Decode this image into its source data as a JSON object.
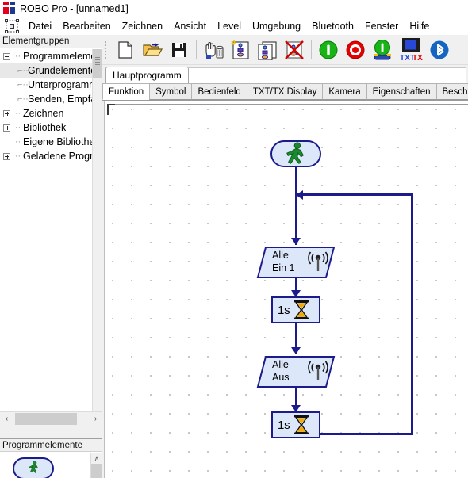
{
  "window": {
    "title": "ROBO Pro - [unnamed1]",
    "app_icon": "fischertechnik-ft-logo-icon"
  },
  "menubar": {
    "system_icon": "program-node-icon",
    "items": [
      {
        "label": "Datei"
      },
      {
        "label": "Bearbeiten"
      },
      {
        "label": "Zeichnen"
      },
      {
        "label": "Ansicht"
      },
      {
        "label": "Level"
      },
      {
        "label": "Umgebung"
      },
      {
        "label": "Bluetooth"
      },
      {
        "label": "Fenster"
      },
      {
        "label": "Hilfe"
      }
    ]
  },
  "toolbar": {
    "buttons": [
      {
        "name": "new-file-button",
        "icon": "new-document-icon",
        "label": "Neu"
      },
      {
        "name": "open-file-button",
        "icon": "open-folder-icon",
        "label": "Öffnen"
      },
      {
        "name": "save-file-button",
        "icon": "floppy-disk-save-icon",
        "label": "Speichern"
      },
      {
        "name": "delete-tool-button",
        "icon": "hand-trash-icon",
        "label": "Löschen"
      },
      {
        "name": "new-subprogram-button",
        "icon": "new-subprogram-icon",
        "label": "Neues Unterprogramm"
      },
      {
        "name": "copy-subprogram-button",
        "icon": "copy-subprogram-icon",
        "label": "Unterprogramm kopieren"
      },
      {
        "name": "delete-subprogram-button",
        "icon": "delete-subprogram-icon",
        "label": "Unterprogramm löschen"
      },
      {
        "name": "start-button",
        "icon": "green-start-icon",
        "label": "Start"
      },
      {
        "name": "stop-button",
        "icon": "red-stop-icon",
        "label": "Stop"
      },
      {
        "name": "start-robot-button",
        "icon": "green-start-robot-icon",
        "label": "Start im Download-Modus"
      },
      {
        "name": "txt-interface-button",
        "icon": "txt-tx-controller-icon",
        "label": "TXT/TX"
      },
      {
        "name": "bluetooth-button",
        "icon": "bluetooth-icon",
        "label": "Bluetooth"
      }
    ]
  },
  "tree_panel": {
    "header": "Elementgruppen",
    "items": [
      {
        "label": "Programmelemente",
        "level": 0,
        "toggle": "minus",
        "selected": false
      },
      {
        "label": "Grundelemente",
        "level": 1,
        "toggle": "none",
        "selected": true
      },
      {
        "label": "Unterprogramme",
        "level": 1,
        "toggle": "none",
        "selected": false
      },
      {
        "label": "Senden, Empfangen",
        "level": 1,
        "toggle": "none",
        "selected": false
      },
      {
        "label": "Zeichnen",
        "level": 0,
        "toggle": "plus",
        "selected": false
      },
      {
        "label": "Bibliothek",
        "level": 0,
        "toggle": "plus",
        "selected": false
      },
      {
        "label": "Eigene Bibliothek",
        "level": 0,
        "toggle": "none",
        "selected": false
      },
      {
        "label": "Geladene Programme",
        "level": 0,
        "toggle": "plus",
        "selected": false
      }
    ],
    "hscroll": {
      "left_arrow": "‹",
      "right_arrow": "›"
    }
  },
  "elements_panel": {
    "header": "Programmelemente",
    "up_arrow": "∧",
    "items": [
      {
        "name": "element-start",
        "icon": "green-runner-start-icon"
      }
    ]
  },
  "document": {
    "tabs": [
      {
        "label": "Hauptprogramm",
        "active": true
      }
    ],
    "sub_tabs": [
      {
        "label": "Funktion",
        "active": true
      },
      {
        "label": "Symbol",
        "active": false
      },
      {
        "label": "Bedienfeld",
        "active": false
      },
      {
        "label": "TXT/TX Display",
        "active": false
      },
      {
        "label": "Kamera",
        "active": false
      },
      {
        "label": "Eigenschaften",
        "active": false
      },
      {
        "label": "Beschreibung",
        "active": false
      }
    ]
  },
  "flowchart": {
    "nodes": [
      {
        "id": "start",
        "type": "start",
        "icon": "green-runner-start-icon",
        "label": ""
      },
      {
        "id": "out1",
        "type": "output",
        "line1": "Alle",
        "line2": "Ein 1",
        "icon": "radio-wave-output-icon"
      },
      {
        "id": "wait1",
        "type": "wait",
        "label": "1s",
        "icon": "hourglass-icon"
      },
      {
        "id": "out2",
        "type": "output",
        "line1": "Alle",
        "line2": "Aus",
        "icon": "radio-wave-output-icon"
      },
      {
        "id": "wait2",
        "type": "wait",
        "label": "1s",
        "icon": "hourglass-icon"
      }
    ],
    "colors": {
      "node_fill": "#dce8fa",
      "node_border": "#1b1b8c",
      "connector": "#1b1b8c",
      "start_figure": "#1a8a2e",
      "hourglass_sand": "#f5a800"
    }
  }
}
